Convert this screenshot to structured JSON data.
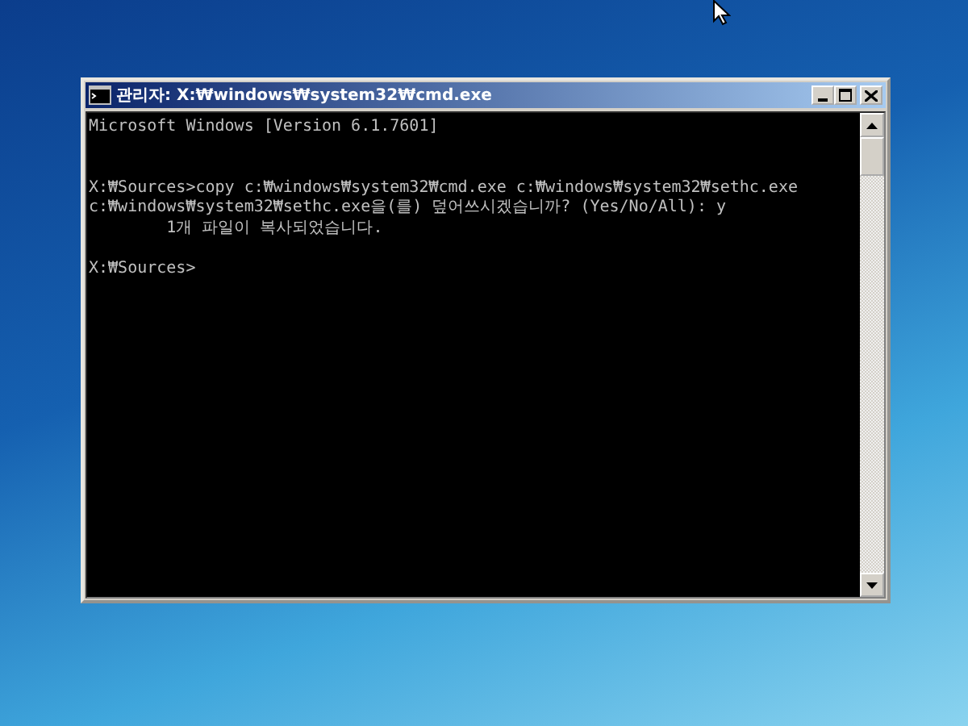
{
  "window": {
    "title": "관리자: X:₩windows₩system32₩cmd.exe"
  },
  "console": {
    "blocks": [
      {
        "lines": [
          "Microsoft Windows [Version 6.1.7601]"
        ],
        "kind": "wide"
      },
      {
        "lines": [
          "X:₩Sources>copy c:₩windows₩system32₩cmd.exe c:₩windows₩system32₩sethc.exe",
          "c:₩windows₩system32₩sethc.exe을(를) 덮어쓰시겠습니까? (Yes/No/All): y",
          "        1개 파일이 복사되었습니다."
        ],
        "kind": "spaced"
      },
      {
        "lines": [
          "X:₩Sources>"
        ],
        "kind": "last"
      }
    ]
  }
}
